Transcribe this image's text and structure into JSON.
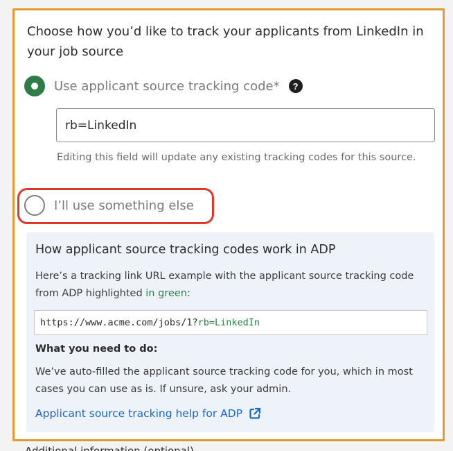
{
  "panel": {
    "heading": "Choose how you’d like to track your applicants from LinkedIn in your job source",
    "options": {
      "use_code_label": "Use applicant source tracking code*",
      "use_code_selected": true,
      "other_label": "I’ll use something else",
      "other_selected": false
    },
    "help_icon_glyph": "?",
    "tracking_code_input": {
      "value": "rb=LinkedIn",
      "hint": "Editing this field will update any existing tracking codes for this source."
    },
    "info": {
      "title": "How applicant source tracking codes work in ADP",
      "desc_prefix": "Here’s a tracking link URL example with the applicant source tracking code from ADP highlighted ",
      "desc_green": "in green",
      "desc_suffix": ":",
      "url_base": "https://www.acme.com/jobs/1?",
      "url_code": "rb=LinkedIn",
      "todo_title": "What you need to do:",
      "todo_desc": "We’ve auto-filled the applicant source tracking code for you, which in most cases you can use as is. If unsure, ask your admin.",
      "help_link": "Applicant source tracking help for ADP"
    }
  },
  "below_partial_text": "Additional information (optional)",
  "colors": {
    "panel_border": "#e39a2e",
    "selected_radio": "#2e7d47",
    "highlight_ring": "#d93a2b",
    "info_background": "#eef3fa",
    "link": "#1a66c4",
    "code_green": "#2e7d47"
  },
  "icons": {
    "help": "question-circle-icon",
    "external_link": "external-link-icon"
  }
}
